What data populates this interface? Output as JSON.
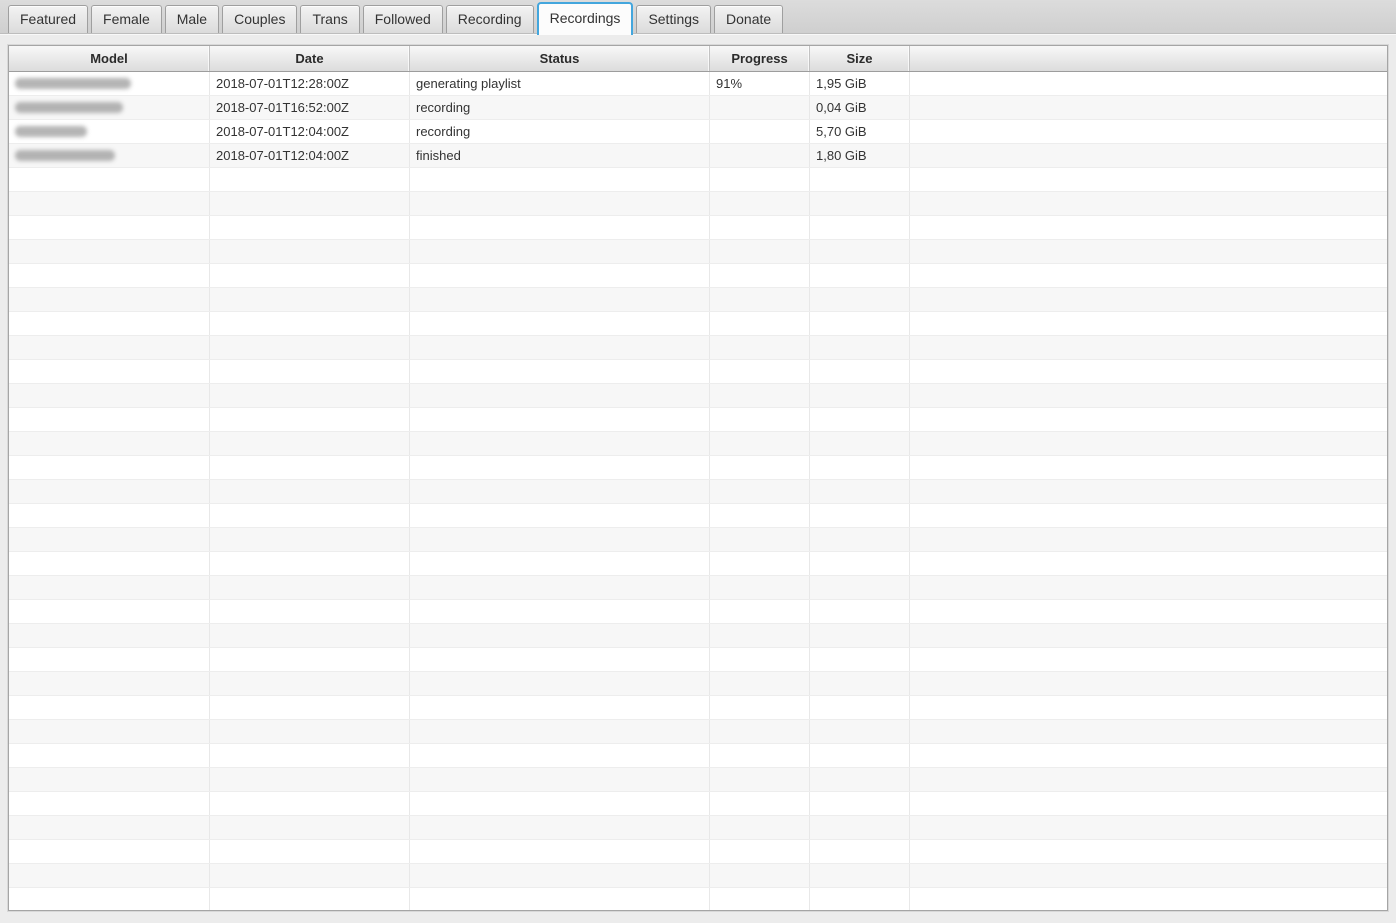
{
  "tabs": {
    "items": [
      "Featured",
      "Female",
      "Male",
      "Couples",
      "Trans",
      "Followed",
      "Recording",
      "Recordings",
      "Settings",
      "Donate"
    ],
    "active": "Recordings"
  },
  "table": {
    "columns": {
      "model": "Model",
      "date": "Date",
      "status": "Status",
      "progress": "Progress",
      "size": "Size",
      "filler": ""
    },
    "rows": [
      {
        "model_redacted": true,
        "model_blur_width": 116,
        "date": "2018-07-01T12:28:00Z",
        "status": "generating playlist",
        "progress": "91%",
        "size": "1,95 GiB"
      },
      {
        "model_redacted": true,
        "model_blur_width": 108,
        "date": "2018-07-01T16:52:00Z",
        "status": "recording",
        "progress": "",
        "size": "0,04 GiB"
      },
      {
        "model_redacted": true,
        "model_blur_width": 72,
        "date": "2018-07-01T12:04:00Z",
        "status": "recording",
        "progress": "",
        "size": "5,70 GiB"
      },
      {
        "model_redacted": true,
        "model_blur_width": 100,
        "date": "2018-07-01T12:04:00Z",
        "status": "finished",
        "progress": "",
        "size": "1,80 GiB"
      }
    ],
    "empty_row_count": 31
  },
  "colors": {
    "accent_active_tab_border": "#43a6dd",
    "row_stripe": "#f7f7f7",
    "header_text": "#2b2b2b"
  }
}
